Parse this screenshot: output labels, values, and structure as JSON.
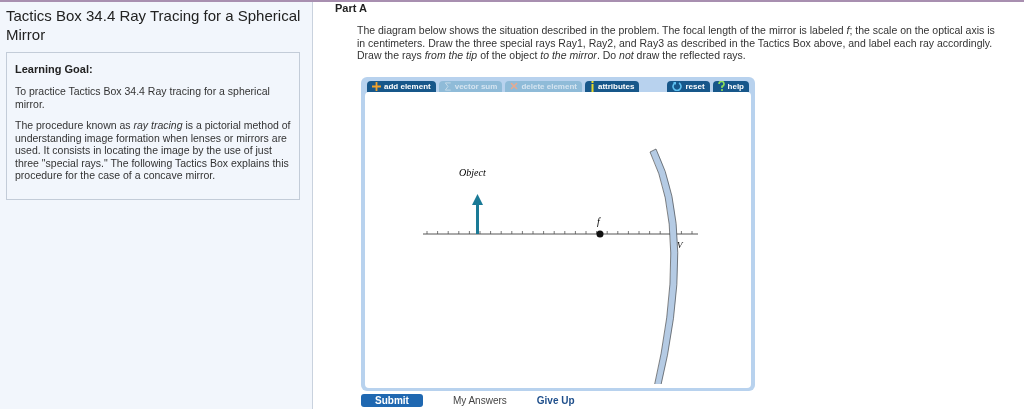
{
  "sidebar": {
    "title": "Tactics Box 34.4 Ray Tracing for a Spherical Mirror",
    "goal_heading": "Learning Goal:",
    "paragraphs": [
      "To practice Tactics Box 34.4 Ray tracing for a spherical mirror.",
      "The procedure known as *ray tracing* is a pictorial method of understanding image formation when lenses or mirrors are used. It consists in locating the image by the use of just three \"special rays.\" The following Tactics Box explains this procedure for the case of a concave mirror."
    ]
  },
  "part": {
    "title": "Part A",
    "instructions": "The diagram below shows the situation described in the problem. The focal length of the mirror is labeled *f*; the scale on the optical axis is in centimeters. Draw the three special rays Ray1, Ray2, and Ray3 as described in the Tactics Box above, and label each ray accordingly. Draw the rays *from the tip* of the object *to the mirror*. Do *not* draw the reflected rays."
  },
  "toolbar": [
    {
      "label": "add element",
      "kind": "add",
      "disabled": false
    },
    {
      "label": "vector sum",
      "kind": "sum",
      "disabled": true
    },
    {
      "label": "delete element",
      "kind": "delete",
      "disabled": true
    },
    {
      "label": "attributes",
      "kind": "info",
      "disabled": false
    },
    {
      "label": "reset",
      "kind": "reset",
      "disabled": false
    },
    {
      "label": "help",
      "kind": "help",
      "disabled": false
    }
  ],
  "diagram": {
    "object_label": "Object",
    "focal_label": "f",
    "vertex_label": "V"
  },
  "footer": {
    "submit": "Submit",
    "my_answers": "My Answers",
    "give_up": "Give Up"
  }
}
